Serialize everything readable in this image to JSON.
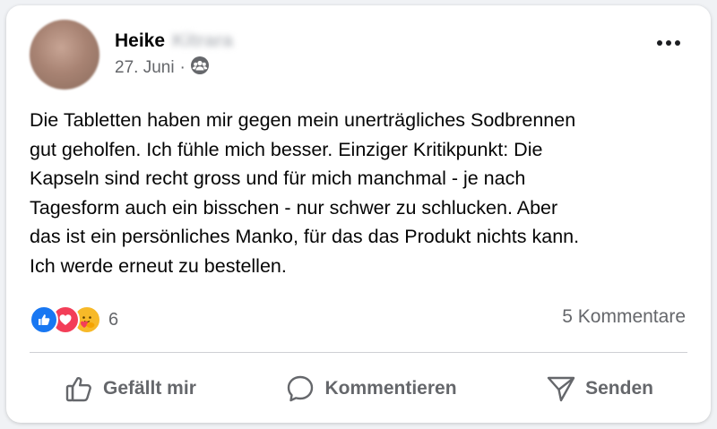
{
  "post": {
    "author_first": "Heike",
    "author_last_blurred": "Kitrara",
    "date": "27. Juni",
    "dot": "·",
    "audience_icon": "friends-icon",
    "text": "Die Tabletten haben mir gegen mein unerträgliches Sodbrennen\ngut geholfen. Ich fühle mich besser. Einziger Kritikpunkt: Die\nKapseln sind recht gross und für mich manchmal - je nach\nTagesform auch ein bisschen - nur schwer zu schlucken. Aber\ndas ist ein persönliches Manko, für das das Produkt nichts kann.\nIch werde erneut zu bestellen."
  },
  "reactions": {
    "types": [
      "like-icon",
      "love-icon",
      "care-icon"
    ],
    "count": "6",
    "comments": "5 Kommentare"
  },
  "actions": {
    "like_label": "Gefällt mir",
    "comment_label": "Kommentieren",
    "share_label": "Senden"
  },
  "colors": {
    "like": "#1877f2",
    "love": "#f33e58",
    "care": "#f7b928",
    "secondary_text": "#65676b"
  }
}
